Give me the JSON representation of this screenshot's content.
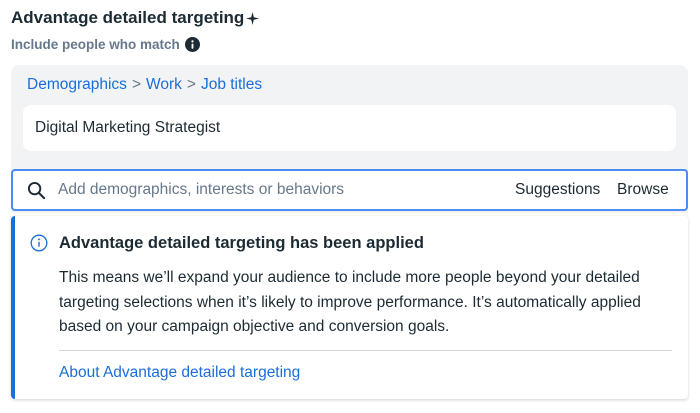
{
  "header": {
    "title": "Advantage detailed targeting",
    "subtitle": "Include people who match"
  },
  "breadcrumb": {
    "items": [
      "Demographics",
      "Work",
      "Job titles"
    ],
    "separator": ">"
  },
  "selection": {
    "value": "Digital Marketing Strategist"
  },
  "search": {
    "placeholder": "Add demographics, interests or behaviors",
    "suggestions_label": "Suggestions",
    "browse_label": "Browse"
  },
  "notice": {
    "title": "Advantage detailed targeting has been applied",
    "body": "This means we’ll expand your audience to include more people beyond your detailed targeting selections when it’s likely to improve performance. It’s automatically applied based on your campaign objective and conversion goals.",
    "link": "About Advantage detailed targeting"
  },
  "colors": {
    "accent": "#1a6ed8",
    "focus_border": "#4c8bf5",
    "panel_bg": "#f2f3f5",
    "text_primary": "#1c2b33",
    "text_secondary": "#67788a"
  },
  "icons": {
    "title": "sparkle-icon",
    "subtitle": "info-solid-icon",
    "search": "search-icon",
    "notice": "info-outline-icon"
  }
}
